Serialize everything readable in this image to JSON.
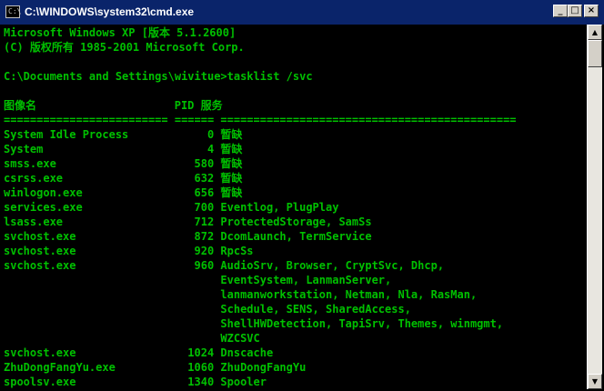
{
  "window": {
    "title": "C:\\WINDOWS\\system32\\cmd.exe",
    "icon_text": "C:\\",
    "buttons": {
      "minimize": "_",
      "maximize": "□",
      "close": "×"
    }
  },
  "console": {
    "text_color": "#00c000",
    "background_color": "#000000",
    "lines": [
      "Microsoft Windows XP [版本 5.1.2600]",
      "(C) 版权所有 1985-2001 Microsoft Corp.",
      "",
      "C:\\Documents and Settings\\wivitue>tasklist /svc",
      "",
      "图像名                     PID 服务",
      "========================= ====== =============================================",
      "System Idle Process            0 暂缺",
      "System                         4 暂缺",
      "smss.exe                     580 暂缺",
      "csrss.exe                    632 暂缺",
      "winlogon.exe                 656 暂缺",
      "services.exe                 700 Eventlog, PlugPlay",
      "lsass.exe                    712 ProtectedStorage, SamSs",
      "svchost.exe                  872 DcomLaunch, TermService",
      "svchost.exe                  920 RpcSs",
      "svchost.exe                  960 AudioSrv, Browser, CryptSvc, Dhcp,",
      "                                 EventSystem, LanmanServer,",
      "                                 lanmanworkstation, Netman, Nla, RasMan,",
      "                                 Schedule, SENS, SharedAccess,",
      "                                 ShellHWDetection, TapiSrv, Themes, winmgmt,",
      "                                 WZCSVC",
      "svchost.exe                 1024 Dnscache",
      "ZhuDongFangYu.exe           1060 ZhuDongFangYu",
      "spoolsv.exe                 1340 Spooler"
    ]
  },
  "scrollbar": {
    "up_arrow": "▲",
    "down_arrow": "▼"
  }
}
